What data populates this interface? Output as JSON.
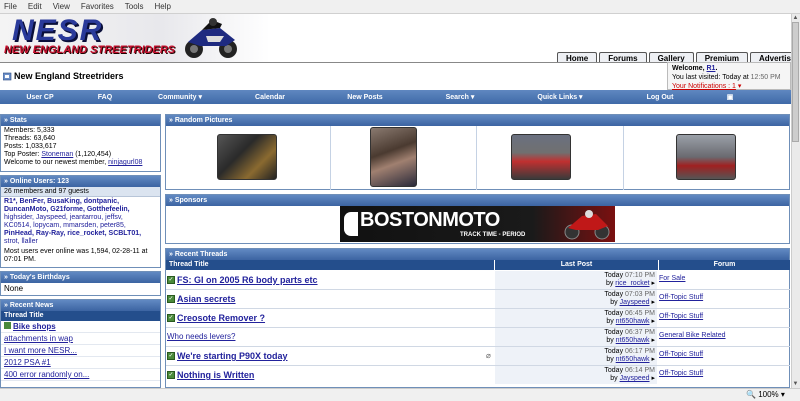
{
  "menubar": [
    "File",
    "Edit",
    "View",
    "Favorites",
    "Tools",
    "Help"
  ],
  "logo": {
    "title": "NESR",
    "subtitle": "NEW ENGLAND STREETRIDERS"
  },
  "tabs": [
    "Home",
    "Forums",
    "Gallery",
    "Premium",
    "Advertise"
  ],
  "welcome": {
    "prefix": "Welcome, ",
    "user": "R1",
    "suffix": ".",
    "visited": "You last visited: Today at ",
    "time": "12:50 PM",
    "notifications": "Your Notifications : 1"
  },
  "site_title": "New England Streetriders",
  "navbar": [
    "User CP",
    "FAQ",
    "Community ▾",
    "Calendar",
    "New Posts",
    "Search ▾",
    "Quick Links ▾",
    "Log Out"
  ],
  "stats": {
    "title": "» Stats",
    "members": "Members: 5,333",
    "threads": "Threads: 63,640",
    "posts": "Posts: 1,033,617",
    "top_prefix": "Top Poster: ",
    "top_user": "Stoneman",
    "top_count": " (1,120,454)",
    "welcome_prefix": "Welcome to our newest member, ",
    "newest": "ninjagurl08"
  },
  "online": {
    "title": "» Online Users: 123",
    "summary": "26 members and 97 guests",
    "lines": [
      "R1*, BenFer, BusaKing, dontpanic,",
      "DuncanMoto, G21forme, Gotthefeelin,",
      "highsider, Jayspeed, jeantarrou, jeffsv,",
      "KC0514, lopycam, mmarsden, peter85,",
      "PinHead, Ray-Ray, rice_rocket, SCBLT01,",
      "strot, llaller"
    ],
    "record": "Most users ever online was 1,594, 02-28-11 at 07:01 PM."
  },
  "birthdays": {
    "title": "» Today's Birthdays",
    "value": "None"
  },
  "recent_news": {
    "title": "» Recent News",
    "col": "Thread Title",
    "items": [
      "Bike shops",
      "attachments in wap",
      "I want more NESR...",
      "2012 PSA #1",
      "400 error randomly on..."
    ]
  },
  "random_pictures": {
    "title": "» Random Pictures"
  },
  "sponsors": {
    "title": "» Sponsors",
    "brand": "BOSTONMOTO",
    "tagline": "TRACK TIME - PERIOD"
  },
  "recent_threads": {
    "title": "» Recent Threads",
    "cols": [
      "Thread Title",
      "Last Post",
      "Forum"
    ],
    "rows": [
      {
        "title": "FS: GI on 2005 R6 body parts etc",
        "date": "Today",
        "time": "07:10 PM",
        "by": "by ",
        "user": "rice_rocket",
        "forum": "For Sale"
      },
      {
        "title": "Asian secrets",
        "date": "Today",
        "time": "07:03 PM",
        "by": "by ",
        "user": "Jayspeed",
        "forum": "Off-Topic Stuff"
      },
      {
        "title": "Creosote Remover ?",
        "date": "Today",
        "time": "06:45 PM",
        "by": "by ",
        "user": "nt650hawk",
        "forum": "Off-Topic Stuff"
      },
      {
        "title": "Who needs levers?",
        "date": "Today",
        "time": "06:37 PM",
        "by": "by ",
        "user": "nt650hawk",
        "forum": "General Bike Related"
      },
      {
        "title": "We're starting P90X today",
        "date": "Today",
        "time": "06:17 PM",
        "by": "by ",
        "user": "nt650hawk",
        "forum": "Off-Topic Stuff"
      },
      {
        "title": "Nothing is Written",
        "date": "Today",
        "time": "06:14 PM",
        "by": "by ",
        "user": "Jayspeed",
        "forum": "Off-Topic Stuff"
      }
    ]
  },
  "zoom": "100%"
}
